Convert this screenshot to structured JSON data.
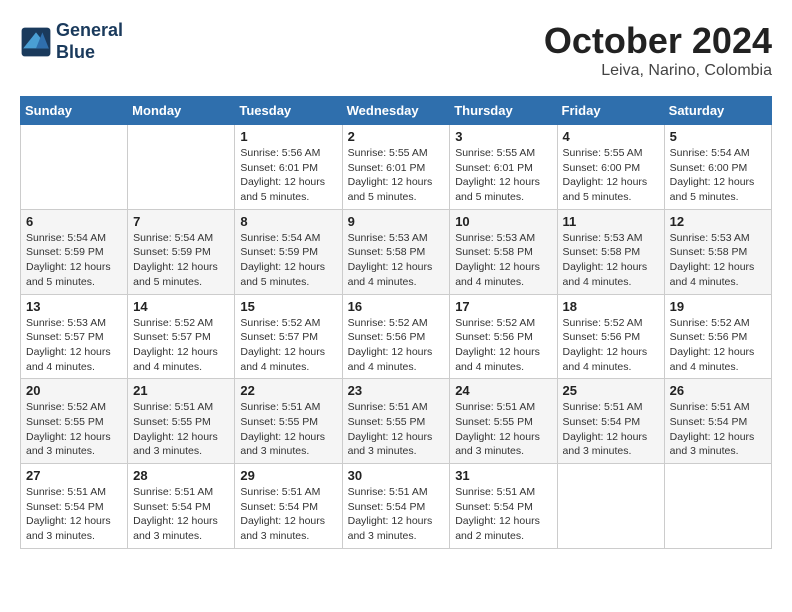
{
  "header": {
    "logo_line1": "General",
    "logo_line2": "Blue",
    "month": "October 2024",
    "location": "Leiva, Narino, Colombia"
  },
  "weekdays": [
    "Sunday",
    "Monday",
    "Tuesday",
    "Wednesday",
    "Thursday",
    "Friday",
    "Saturday"
  ],
  "weeks": [
    [
      {
        "day": "",
        "detail": ""
      },
      {
        "day": "",
        "detail": ""
      },
      {
        "day": "1",
        "detail": "Sunrise: 5:56 AM\nSunset: 6:01 PM\nDaylight: 12 hours and 5 minutes."
      },
      {
        "day": "2",
        "detail": "Sunrise: 5:55 AM\nSunset: 6:01 PM\nDaylight: 12 hours and 5 minutes."
      },
      {
        "day": "3",
        "detail": "Sunrise: 5:55 AM\nSunset: 6:01 PM\nDaylight: 12 hours and 5 minutes."
      },
      {
        "day": "4",
        "detail": "Sunrise: 5:55 AM\nSunset: 6:00 PM\nDaylight: 12 hours and 5 minutes."
      },
      {
        "day": "5",
        "detail": "Sunrise: 5:54 AM\nSunset: 6:00 PM\nDaylight: 12 hours and 5 minutes."
      }
    ],
    [
      {
        "day": "6",
        "detail": "Sunrise: 5:54 AM\nSunset: 5:59 PM\nDaylight: 12 hours and 5 minutes."
      },
      {
        "day": "7",
        "detail": "Sunrise: 5:54 AM\nSunset: 5:59 PM\nDaylight: 12 hours and 5 minutes."
      },
      {
        "day": "8",
        "detail": "Sunrise: 5:54 AM\nSunset: 5:59 PM\nDaylight: 12 hours and 5 minutes."
      },
      {
        "day": "9",
        "detail": "Sunrise: 5:53 AM\nSunset: 5:58 PM\nDaylight: 12 hours and 4 minutes."
      },
      {
        "day": "10",
        "detail": "Sunrise: 5:53 AM\nSunset: 5:58 PM\nDaylight: 12 hours and 4 minutes."
      },
      {
        "day": "11",
        "detail": "Sunrise: 5:53 AM\nSunset: 5:58 PM\nDaylight: 12 hours and 4 minutes."
      },
      {
        "day": "12",
        "detail": "Sunrise: 5:53 AM\nSunset: 5:58 PM\nDaylight: 12 hours and 4 minutes."
      }
    ],
    [
      {
        "day": "13",
        "detail": "Sunrise: 5:53 AM\nSunset: 5:57 PM\nDaylight: 12 hours and 4 minutes."
      },
      {
        "day": "14",
        "detail": "Sunrise: 5:52 AM\nSunset: 5:57 PM\nDaylight: 12 hours and 4 minutes."
      },
      {
        "day": "15",
        "detail": "Sunrise: 5:52 AM\nSunset: 5:57 PM\nDaylight: 12 hours and 4 minutes."
      },
      {
        "day": "16",
        "detail": "Sunrise: 5:52 AM\nSunset: 5:56 PM\nDaylight: 12 hours and 4 minutes."
      },
      {
        "day": "17",
        "detail": "Sunrise: 5:52 AM\nSunset: 5:56 PM\nDaylight: 12 hours and 4 minutes."
      },
      {
        "day": "18",
        "detail": "Sunrise: 5:52 AM\nSunset: 5:56 PM\nDaylight: 12 hours and 4 minutes."
      },
      {
        "day": "19",
        "detail": "Sunrise: 5:52 AM\nSunset: 5:56 PM\nDaylight: 12 hours and 4 minutes."
      }
    ],
    [
      {
        "day": "20",
        "detail": "Sunrise: 5:52 AM\nSunset: 5:55 PM\nDaylight: 12 hours and 3 minutes."
      },
      {
        "day": "21",
        "detail": "Sunrise: 5:51 AM\nSunset: 5:55 PM\nDaylight: 12 hours and 3 minutes."
      },
      {
        "day": "22",
        "detail": "Sunrise: 5:51 AM\nSunset: 5:55 PM\nDaylight: 12 hours and 3 minutes."
      },
      {
        "day": "23",
        "detail": "Sunrise: 5:51 AM\nSunset: 5:55 PM\nDaylight: 12 hours and 3 minutes."
      },
      {
        "day": "24",
        "detail": "Sunrise: 5:51 AM\nSunset: 5:55 PM\nDaylight: 12 hours and 3 minutes."
      },
      {
        "day": "25",
        "detail": "Sunrise: 5:51 AM\nSunset: 5:54 PM\nDaylight: 12 hours and 3 minutes."
      },
      {
        "day": "26",
        "detail": "Sunrise: 5:51 AM\nSunset: 5:54 PM\nDaylight: 12 hours and 3 minutes."
      }
    ],
    [
      {
        "day": "27",
        "detail": "Sunrise: 5:51 AM\nSunset: 5:54 PM\nDaylight: 12 hours and 3 minutes."
      },
      {
        "day": "28",
        "detail": "Sunrise: 5:51 AM\nSunset: 5:54 PM\nDaylight: 12 hours and 3 minutes."
      },
      {
        "day": "29",
        "detail": "Sunrise: 5:51 AM\nSunset: 5:54 PM\nDaylight: 12 hours and 3 minutes."
      },
      {
        "day": "30",
        "detail": "Sunrise: 5:51 AM\nSunset: 5:54 PM\nDaylight: 12 hours and 3 minutes."
      },
      {
        "day": "31",
        "detail": "Sunrise: 5:51 AM\nSunset: 5:54 PM\nDaylight: 12 hours and 2 minutes."
      },
      {
        "day": "",
        "detail": ""
      },
      {
        "day": "",
        "detail": ""
      }
    ]
  ]
}
